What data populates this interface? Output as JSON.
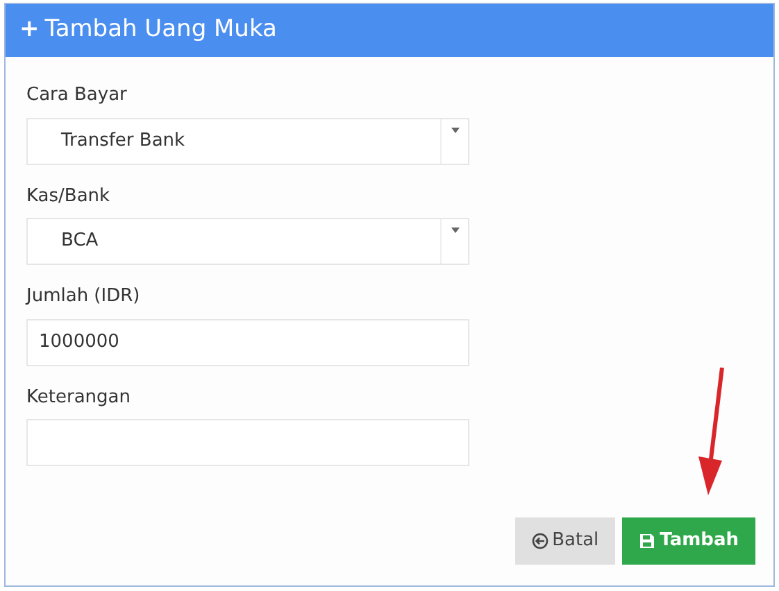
{
  "panel": {
    "title": "Tambah Uang Muka",
    "title_icon": "+"
  },
  "fields": [
    {
      "label": "Cara Bayar",
      "kind": "select",
      "value": "Transfer Bank"
    },
    {
      "label": "Kas/Bank",
      "kind": "select",
      "value": "BCA"
    },
    {
      "label": "Jumlah (IDR)",
      "kind": "text",
      "value": "1000000"
    },
    {
      "label": "Keterangan",
      "kind": "text"
    }
  ],
  "buttons": [
    {
      "label": "Batal",
      "kind": "back"
    },
    {
      "label": "Tambah",
      "kind": "save"
    }
  ]
}
